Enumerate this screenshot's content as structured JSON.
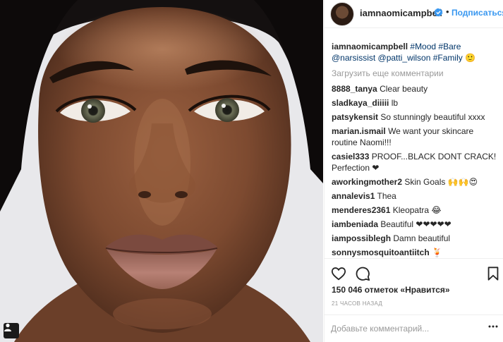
{
  "post": {
    "username": "iamnaomicampbell",
    "separator": "•",
    "follow_label": "Подписаться",
    "caption": {
      "username": "iamnaomicampbell",
      "line1": "#Mood #Bare",
      "line2": "@narsissist @patti_wilson #Family 🙂"
    },
    "load_more": "Загрузить еще комментарии",
    "comments": [
      {
        "user": "8888_tanya",
        "text": "Clear beauty"
      },
      {
        "user": "sladkaya_diiiii",
        "text": "lb"
      },
      {
        "user": "patsykensit",
        "text": "So stunningly beautiful xxxx"
      },
      {
        "user": "marian.ismail",
        "text": "We want your skincare",
        "text2": "routine Naomi!!!"
      },
      {
        "user": "casiel333",
        "text": "PROOF...BLACK DONT CRACK!",
        "text2": "Perfection ❤"
      },
      {
        "user": "aworkingmother2",
        "text": "Skin Goals 🙌🙌😍"
      },
      {
        "user": "annalevis1",
        "text": "Thea"
      },
      {
        "user": "menderes2361",
        "text": "Kleopatra 😂"
      },
      {
        "user": "iambeniada",
        "text": "Beautiful ❤❤❤❤❤"
      },
      {
        "user": "iampossiblegh",
        "text": "Damn beautiful"
      },
      {
        "user": "sonnysmosquitoantiitch",
        "text": "🍹"
      }
    ],
    "likes": "150 046 отметок «Нравится»",
    "time": "21 ЧАСОВ НАЗАД",
    "add_comment_placeholder": "Добавьте комментарий..."
  },
  "icons": {
    "like": "heart-outline-icon",
    "comment": "speech-bubble-icon",
    "save": "bookmark-icon",
    "verified": "verified-badge-icon",
    "tag": "person-tag-icon",
    "more": "ellipsis-icon"
  },
  "colors": {
    "link": "#003569",
    "follow": "#3897f0",
    "verified": "#3897f0",
    "muted": "#999999"
  }
}
